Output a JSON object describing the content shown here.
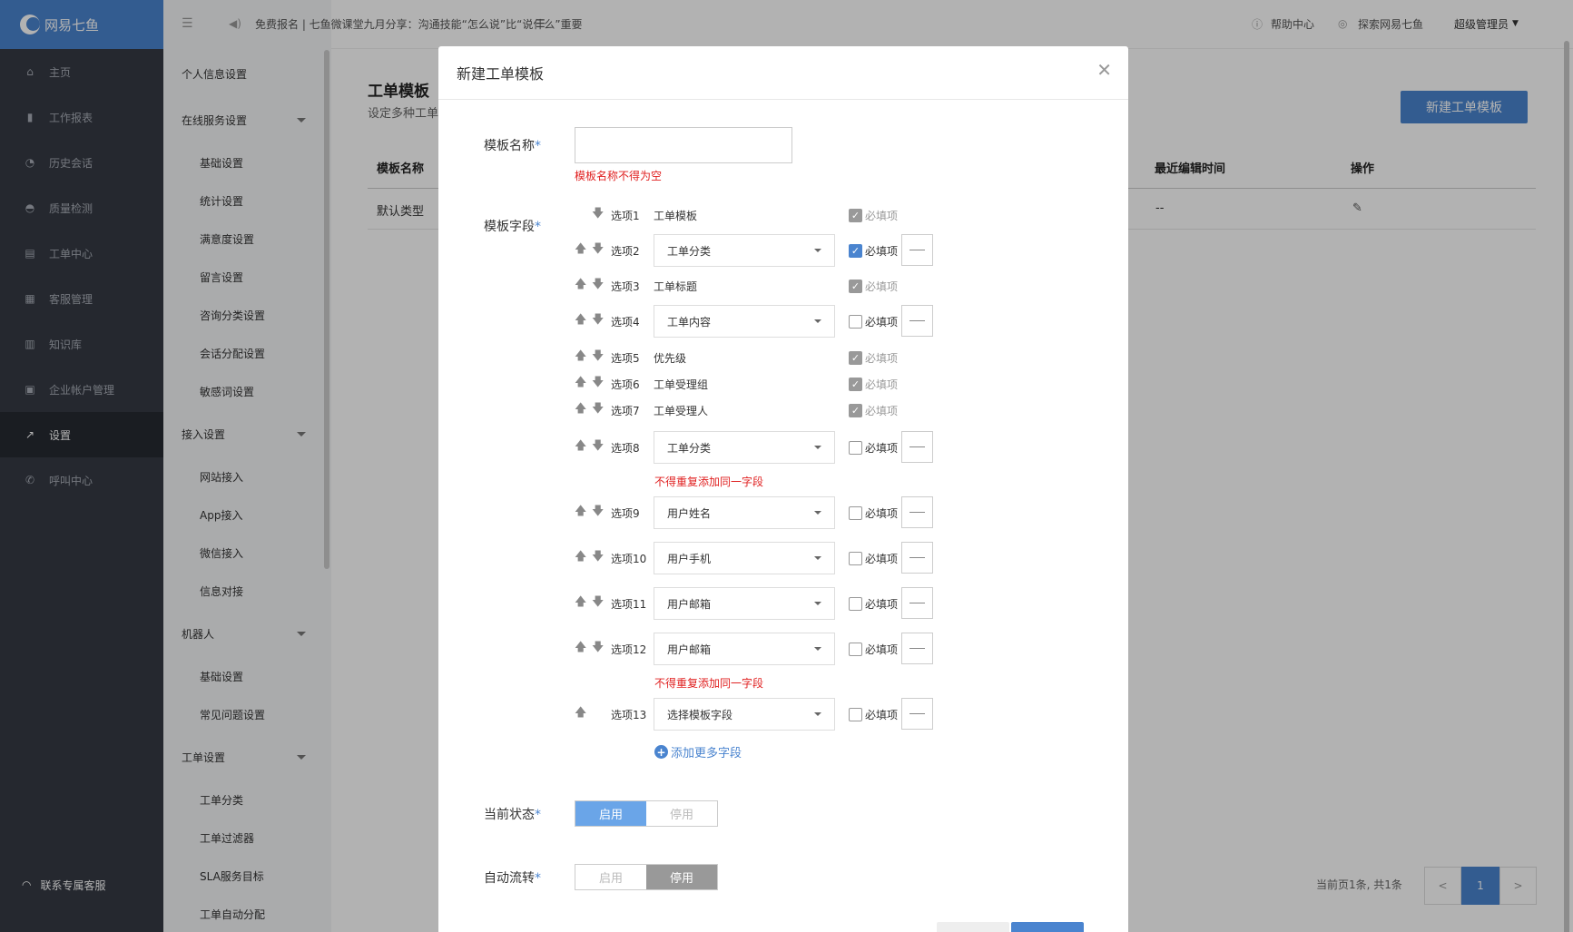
{
  "nav": {
    "logo": "网易七鱼",
    "items": [
      {
        "label": "主页",
        "icon": "home-icon"
      },
      {
        "label": "工作报表",
        "icon": "bar-chart-icon"
      },
      {
        "label": "历史会话",
        "icon": "clock-icon"
      },
      {
        "label": "质量检测",
        "icon": "gauge-icon"
      },
      {
        "label": "工单中心",
        "icon": "ticket-icon"
      },
      {
        "label": "客服管理",
        "icon": "grid-icon"
      },
      {
        "label": "知识库",
        "icon": "book-icon"
      },
      {
        "label": "企业帐户管理",
        "icon": "table-icon"
      },
      {
        "label": "设置",
        "icon": "wrench-icon"
      },
      {
        "label": "呼叫中心",
        "icon": "phone-icon"
      }
    ],
    "support": "联系专属客服"
  },
  "subnav": {
    "top_item": "个人信息设置",
    "groups": [
      {
        "label": "在线服务设置",
        "items": [
          "基础设置",
          "统计设置",
          "满意度设置",
          "留言设置",
          "咨询分类设置",
          "会话分配设置",
          "敏感词设置"
        ]
      },
      {
        "label": "接入设置",
        "items": [
          "网站接入",
          "App接入",
          "微信接入",
          "信息对接"
        ]
      },
      {
        "label": "机器人",
        "items": [
          "基础设置",
          "常见问题设置"
        ]
      },
      {
        "label": "工单设置",
        "items": [
          "工单分类",
          "工单过滤器",
          "SLA服务目标",
          "工单自动分配"
        ]
      }
    ]
  },
  "topbar": {
    "announcement": "免费报名 | 七鱼微课堂九月分享：沟通技能“怎么说”比“说什么”重要",
    "help": "帮助中心",
    "explore": "探索网易七鱼",
    "user": "超级管理员"
  },
  "page": {
    "title": "工单模板",
    "subtitle": "设定多种工单",
    "new_button": "新建工单模板",
    "table": {
      "headers": {
        "name": "模板名称",
        "edited": "最近编辑时间",
        "action": "操作"
      },
      "rows": [
        {
          "name": "默认类型",
          "edited": "--"
        }
      ]
    },
    "pager": {
      "info": "当前页1条, 共1条",
      "prev": "<",
      "current": "1",
      "next": ">"
    }
  },
  "modal": {
    "title": "新建工单模板",
    "name_label": "模板名称",
    "name_value": "",
    "name_error": "模板名称不得为空",
    "fields_label": "模板字段",
    "required_text": "必填项",
    "duplicate_error": "不得重复添加同一字段",
    "fields": [
      {
        "option": "选项1",
        "value": "工单模板",
        "fixed": true,
        "checked": true
      },
      {
        "option": "选项2",
        "value": "工单分类",
        "fixed": false,
        "checked": true
      },
      {
        "option": "选项3",
        "value": "工单标题",
        "fixed": true,
        "checked": true
      },
      {
        "option": "选项4",
        "value": "工单内容",
        "fixed": false,
        "checked": false
      },
      {
        "option": "选项5",
        "value": "优先级",
        "fixed": true,
        "checked": true
      },
      {
        "option": "选项6",
        "value": "工单受理组",
        "fixed": true,
        "checked": true
      },
      {
        "option": "选项7",
        "value": "工单受理人",
        "fixed": true,
        "checked": true
      },
      {
        "option": "选项8",
        "value": "工单分类",
        "fixed": false,
        "checked": false,
        "error": true
      },
      {
        "option": "选项9",
        "value": "用户姓名",
        "fixed": false,
        "checked": false
      },
      {
        "option": "选项10",
        "value": "用户手机",
        "fixed": false,
        "checked": false
      },
      {
        "option": "选项11",
        "value": "用户邮箱",
        "fixed": false,
        "checked": false
      },
      {
        "option": "选项12",
        "value": "用户邮箱",
        "fixed": false,
        "checked": false,
        "error": true
      },
      {
        "option": "选项13",
        "value": "选择模板字段",
        "fixed": false,
        "checked": false
      }
    ],
    "add_more": "添加更多字段",
    "status_label": "当前状态",
    "status_options": [
      "启用",
      "停用"
    ],
    "status_selected": "启用",
    "autoflow_label": "自动流转",
    "autoflow_options": [
      "启用",
      "停用"
    ],
    "autoflow_selected": "停用",
    "colors": {
      "accent": "#4a84cf",
      "error": "#e02020",
      "nav_bg": "#353a44"
    }
  }
}
